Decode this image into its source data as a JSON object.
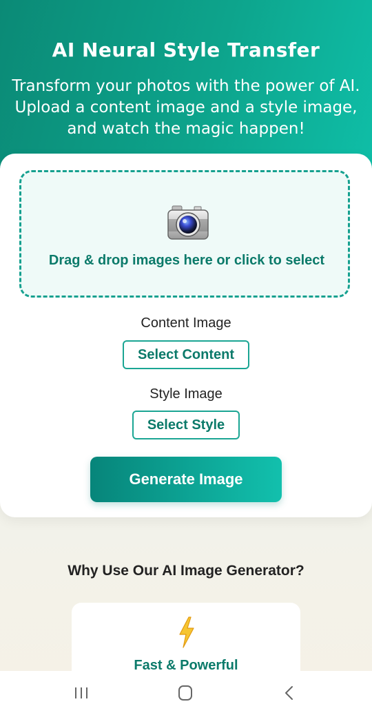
{
  "header": {
    "title": "AI Neural Style Transfer",
    "subtitle_lines": [
      "Transform your photos with the power of AI.",
      "Upload a content image and a style image,",
      "and watch the magic happen!"
    ]
  },
  "upload": {
    "icon": "camera-icon",
    "dropzone_text": "Drag & drop images here or click to select",
    "content_label": "Content Image",
    "content_button": "Select Content",
    "style_label": "Style Image",
    "style_button": "Select Style",
    "generate_button": "Generate Image"
  },
  "why": {
    "title": "Why Use Our AI Image Generator?",
    "features": [
      {
        "icon": "lightning-bolt-icon",
        "title": "Fast & Powerful"
      }
    ]
  },
  "nav": {
    "items": [
      {
        "icon": "recent-apps-icon"
      },
      {
        "icon": "home-icon"
      },
      {
        "icon": "back-icon"
      }
    ]
  },
  "colors": {
    "primary": "#0b8a76",
    "accent": "#12c0ad",
    "text_teal": "#0b7a6a"
  }
}
